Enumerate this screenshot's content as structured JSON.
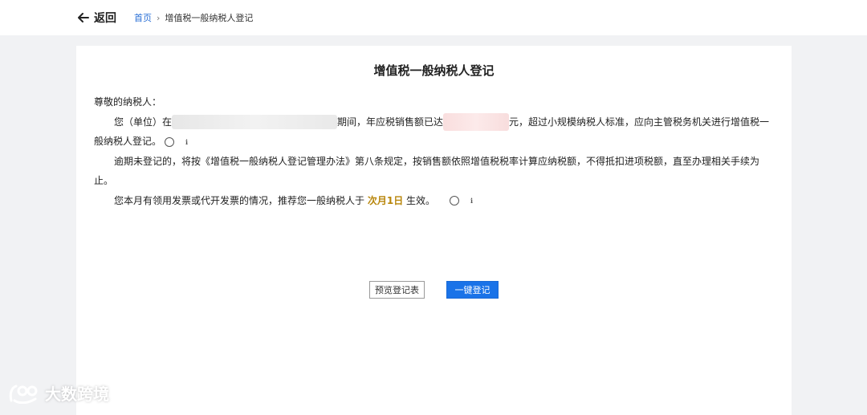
{
  "header": {
    "back_label": "返回",
    "breadcrumb": {
      "home": "首页",
      "separator": "›",
      "current": "增值税一般纳税人登记"
    }
  },
  "card": {
    "title": "增值税一般纳税人登记",
    "greeting": "尊敬的纳税人：",
    "p1_prefix": "您（单位）在",
    "p1_mid": "期间，年应税销售额已达",
    "p1_suffix": "元，超过小规模纳税人标准，应向主管税务机关进行增值税一般纳税人登记。",
    "p2": "逾期未登记的，将按《增值税一般纳税人登记管理办法》第八条规定，按销售额依照增值税税率计算应纳税额，不得抵扣进项税额，直至办理相关手续为止。",
    "p3_prefix": "您本月有领用发票或代开发票的情况，推荐您一般纳税人于",
    "p3_highlight": "次月1日",
    "p3_suffix": "生效。",
    "info_glyph": "i"
  },
  "buttons": {
    "preview": "预览登记表",
    "register": "一键登记"
  },
  "watermark": {
    "text": "大数跨境"
  },
  "colors": {
    "primary": "#1a73e8",
    "link": "#2a6fd6",
    "highlight": "#b8860b",
    "background": "#f1f2f4"
  }
}
